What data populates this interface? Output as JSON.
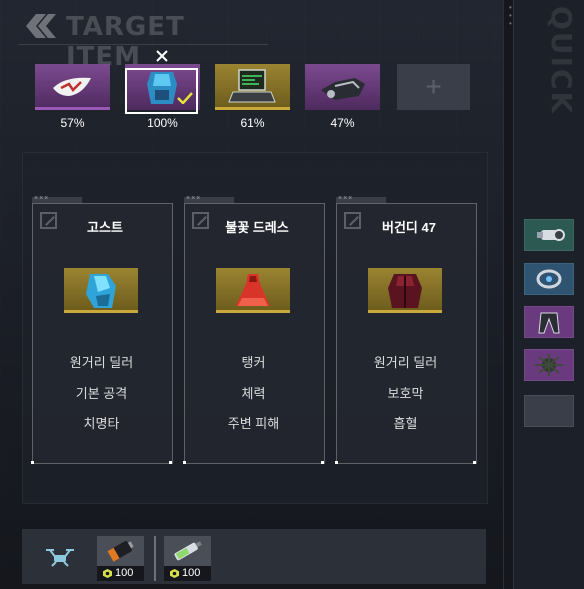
{
  "header": {
    "title": "TARGET ITEM"
  },
  "quick": {
    "label": "QUICK"
  },
  "target_items": [
    {
      "name": "visor",
      "percent": "57%",
      "rarity": "purple",
      "selected": false
    },
    {
      "name": "armor-vest",
      "percent": "100%",
      "rarity": "purple",
      "selected": true
    },
    {
      "name": "terminal",
      "percent": "61%",
      "rarity": "gold",
      "selected": false
    },
    {
      "name": "gauntlet",
      "percent": "47%",
      "rarity": "purple",
      "selected": false
    }
  ],
  "add_slot": {
    "label": "+"
  },
  "cards": [
    {
      "name": "고스트",
      "item": "ghost-coat",
      "stats": [
        "원거리 딜러",
        "기본 공격",
        "치명타"
      ]
    },
    {
      "name": "불꽃 드레스",
      "item": "flame-dress",
      "stats": [
        "탱커",
        "체력",
        "주변 피해"
      ]
    },
    {
      "name": "버건디 47",
      "item": "burgundy-coat",
      "stats": [
        "원거리 딜러",
        "보호막",
        "흡혈"
      ]
    }
  ],
  "quick_slots": [
    {
      "icon": "scope-icon",
      "color": "teal"
    },
    {
      "icon": "ring-icon",
      "color": "blue"
    },
    {
      "icon": "legs-icon",
      "color": "purple"
    },
    {
      "icon": "core-icon",
      "color": "purple"
    },
    {
      "icon": "empty",
      "color": "gray"
    }
  ],
  "consumables": [
    {
      "icon": "battery-icon",
      "count": "100"
    },
    {
      "icon": "tube-icon",
      "count": "100"
    }
  ],
  "colors": {
    "purple_rarity": "#6a3a7e",
    "gold_rarity": "#8a7526",
    "teal_rarity": "#2c5a52",
    "blue_rarity": "#2f5472",
    "check_accent": "#e6e23a"
  }
}
